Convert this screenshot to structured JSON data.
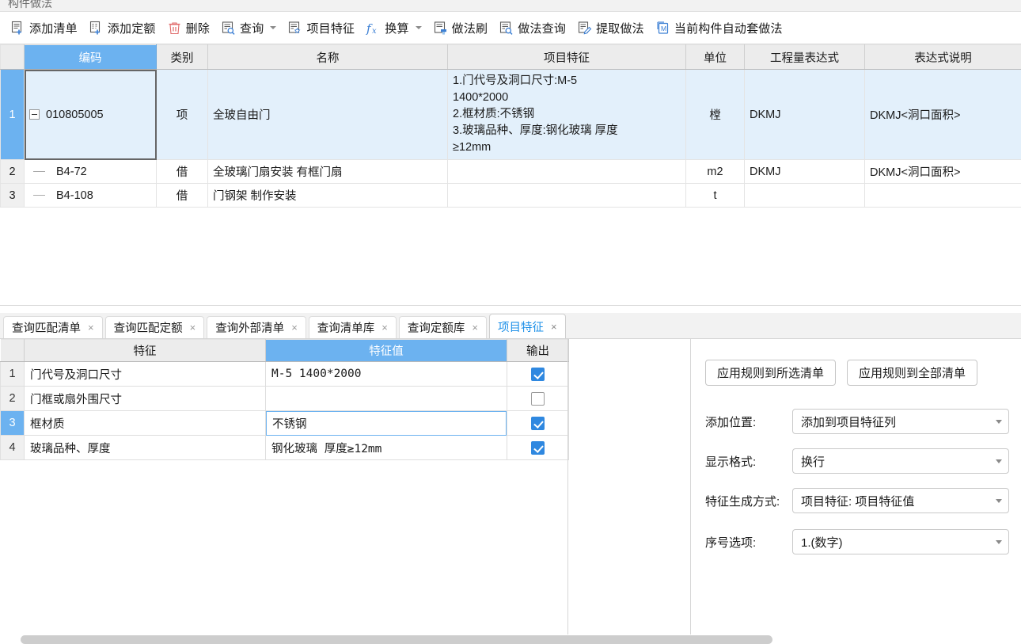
{
  "panel": {
    "title": "构件做法"
  },
  "toolbar": {
    "buttons": [
      {
        "label": "添加清单",
        "icon": "add-list-icon",
        "caret": false
      },
      {
        "label": "添加定额",
        "icon": "add-quota-icon",
        "caret": false
      },
      {
        "label": "删除",
        "icon": "trash-icon",
        "caret": false
      },
      {
        "label": "查询",
        "icon": "query-icon",
        "caret": true
      },
      {
        "label": "项目特征",
        "icon": "project-feature-icon",
        "caret": false
      },
      {
        "label": "换算",
        "icon": "fx-icon",
        "caret": true
      },
      {
        "label": "做法刷",
        "icon": "method-brush-icon",
        "caret": false
      },
      {
        "label": "做法查询",
        "icon": "method-query-icon",
        "caret": false
      },
      {
        "label": "提取做法",
        "icon": "extract-method-icon",
        "caret": false
      },
      {
        "label": "当前构件自动套做法",
        "icon": "auto-apply-icon",
        "caret": false
      }
    ]
  },
  "grid": {
    "columns": [
      {
        "key": "rownum",
        "label": "",
        "selected": false
      },
      {
        "key": "code",
        "label": "编码",
        "selected": true
      },
      {
        "key": "category",
        "label": "类别",
        "selected": false
      },
      {
        "key": "name",
        "label": "名称",
        "selected": false
      },
      {
        "key": "feature",
        "label": "项目特征",
        "selected": false
      },
      {
        "key": "unit",
        "label": "单位",
        "selected": false
      },
      {
        "key": "qty_expr",
        "label": "工程量表达式",
        "selected": false
      },
      {
        "key": "expr_desc",
        "label": "表达式说明",
        "selected": false
      }
    ],
    "rows": [
      {
        "rownum": "1",
        "code": "010805005",
        "category": "项",
        "name": "全玻自由门",
        "feature": "1.门代号及洞口尺寸:M-5\n1400*2000\n2.框材质:不锈钢\n3.玻璃品种、厚度:钢化玻璃  厚度\n≥12mm",
        "unit": "樘",
        "qty_expr": "DKMJ",
        "expr_desc": "DKMJ<洞口面积>",
        "selected": true,
        "level": 0,
        "expanded": true
      },
      {
        "rownum": "2",
        "code": "B4-72",
        "category": "借",
        "name": "全玻璃门扇安装 有框门扇",
        "feature": "",
        "unit": "m2",
        "qty_expr": "DKMJ",
        "expr_desc": "DKMJ<洞口面积>",
        "selected": false,
        "level": 1,
        "expanded": false
      },
      {
        "rownum": "3",
        "code": "B4-108",
        "category": "借",
        "name": "门钢架 制作安装",
        "feature": "",
        "unit": "t",
        "qty_expr": "",
        "expr_desc": "",
        "selected": false,
        "level": 1,
        "expanded": false
      }
    ]
  },
  "tabs": [
    {
      "label": "查询匹配清单",
      "active": false,
      "close": "×"
    },
    {
      "label": "查询匹配定额",
      "active": false,
      "close": "×"
    },
    {
      "label": "查询外部清单",
      "active": false,
      "close": "×"
    },
    {
      "label": "查询清单库",
      "active": false,
      "close": "×"
    },
    {
      "label": "查询定额库",
      "active": false,
      "close": "×"
    },
    {
      "label": "项目特征",
      "active": true,
      "close": "×"
    }
  ],
  "feature_grid": {
    "columns": [
      {
        "key": "rn",
        "label": "",
        "selected": false
      },
      {
        "key": "feature",
        "label": "特征",
        "selected": false
      },
      {
        "key": "value",
        "label": "特征值",
        "selected": true
      },
      {
        "key": "output",
        "label": "输出",
        "selected": false
      }
    ],
    "rows": [
      {
        "rn": "1",
        "feature": "门代号及洞口尺寸",
        "value": "M-5  1400*2000",
        "value_mono": true,
        "output": true,
        "selected": false,
        "editing": false
      },
      {
        "rn": "2",
        "feature": "门框或扇外围尺寸",
        "value": "",
        "value_mono": true,
        "output": false,
        "selected": false,
        "editing": false
      },
      {
        "rn": "3",
        "feature": "框材质",
        "value": "不锈钢",
        "value_mono": false,
        "output": true,
        "selected": true,
        "editing": true
      },
      {
        "rn": "4",
        "feature": "玻璃品种、厚度",
        "value": "钢化玻璃  厚度≥12mm",
        "value_mono": true,
        "output": true,
        "selected": false,
        "editing": false
      }
    ]
  },
  "settings": {
    "buttons": [
      {
        "label": "应用规则到所选清单"
      },
      {
        "label": "应用规则到全部清单"
      }
    ],
    "fields": [
      {
        "label": "添加位置:",
        "value": "添加到项目特征列"
      },
      {
        "label": "显示格式:",
        "value": "换行"
      },
      {
        "label": "特征生成方式:",
        "value": "项目特征: 项目特征值"
      },
      {
        "label": "序号选项:",
        "value": "1.(数字)"
      }
    ]
  },
  "colors": {
    "header_selected": "#6cb2f0",
    "row_selected": "#e3f0fb",
    "accent": "#1e90e8",
    "checkbox_on": "#2f88e0"
  }
}
